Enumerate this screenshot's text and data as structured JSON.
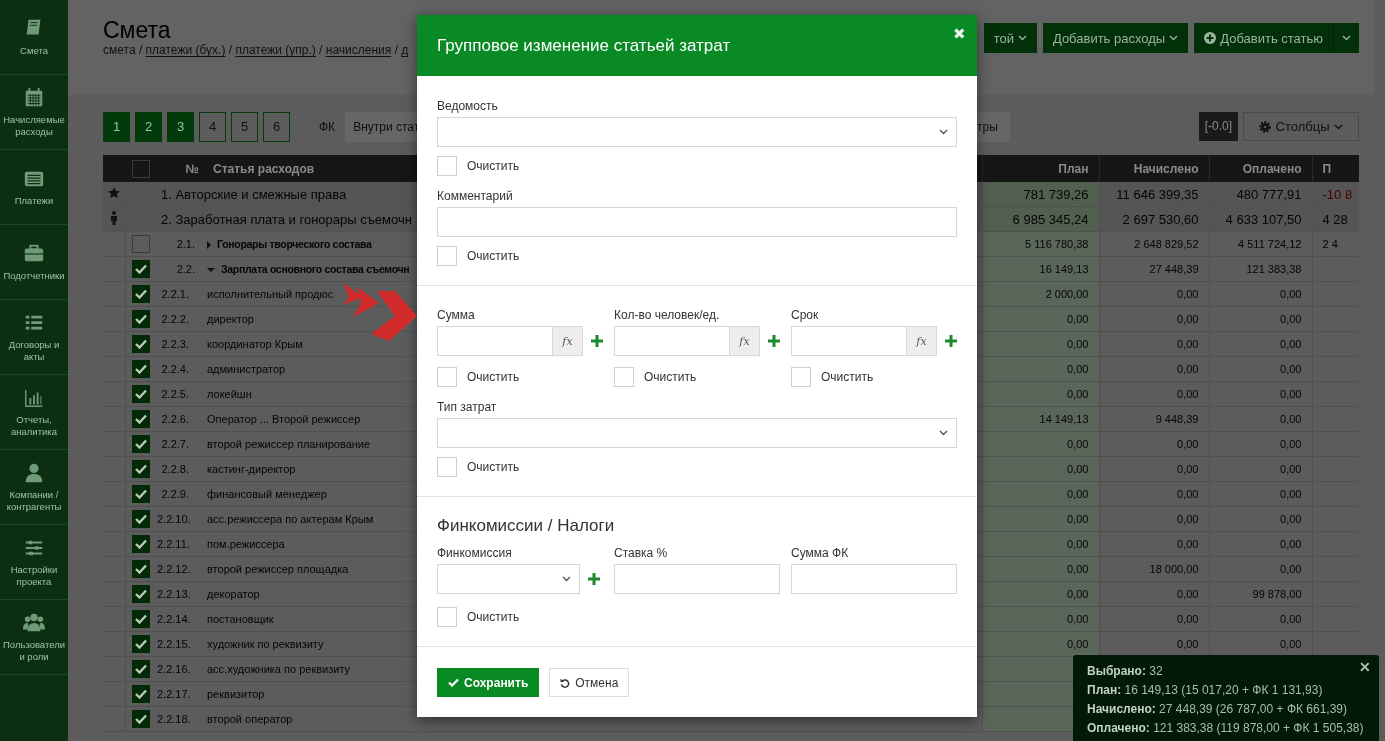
{
  "sidebar": {
    "items": [
      {
        "label": "Смета"
      },
      {
        "label": "Начисляемые расходы"
      },
      {
        "label": "Платежи"
      },
      {
        "label": "Подотчетники"
      },
      {
        "label": "Договоры и акты"
      },
      {
        "label": "Отчеты, аналитика"
      },
      {
        "label": "Компании / контрагенты"
      },
      {
        "label": "Настройки проекта"
      },
      {
        "label": "Пользователи и роли"
      }
    ]
  },
  "header": {
    "title": "Смета",
    "breadcrumbs": [
      {
        "label": "смета",
        "link": false
      },
      {
        "separator": "/",
        "label": "платежи (бух.)",
        "link": true
      },
      {
        "separator": "/",
        "label": "платежи (упр.)",
        "link": true
      },
      {
        "separator": "/",
        "label": "начисления",
        "link": true
      },
      {
        "separator": "/",
        "label": "д",
        "link": true
      }
    ],
    "actions": [
      {
        "label": "той",
        "kind": "dropdown"
      },
      {
        "label": "Добавить расходы",
        "kind": "dropdown"
      },
      {
        "label": "Добавить статью",
        "kind": "split"
      }
    ]
  },
  "toolbar": {
    "pages": [
      {
        "label": "1",
        "active": true
      },
      {
        "label": "2",
        "active": true
      },
      {
        "label": "3",
        "active": true
      },
      {
        "label": "4",
        "active": false
      },
      {
        "label": "5",
        "active": false
      },
      {
        "label": "6",
        "active": false
      }
    ],
    "fk_label": "ФК",
    "fk_select": "Внутри стат",
    "filters_button": "тры",
    "zoom_badge": "[-0.0]",
    "columns_button": "Столбцы"
  },
  "table": {
    "columns": [
      "№",
      "Статья расходов",
      "План",
      "Начислено",
      "Оплачено",
      "П"
    ],
    "header_checked": false,
    "rows": [
      {
        "kind": "group",
        "name": "1. Авторские и смежные права",
        "overdrawn": true,
        "values": [
          "781 739,26",
          "11 646 399,35",
          "480 777,91",
          "-10 8"
        ]
      },
      {
        "kind": "group",
        "name": "2. Заработная плата и гонорары съемочн",
        "overdrawn": false,
        "values": [
          "6 985 345,24",
          "2 697 530,60",
          "4 633 107,50",
          "4 28"
        ]
      },
      {
        "kind": "subgroup",
        "number": "2.1.",
        "name": "Гонорары творческого состава",
        "checked": false,
        "expanded": false,
        "values": [
          "5 116 780,38",
          "2 648 829,52",
          "4 511 724,12",
          "2 4"
        ]
      },
      {
        "kind": "subgroup",
        "number": "2.2.",
        "name": "Зарплата основного состава съемочн",
        "checked": true,
        "expanded": true,
        "values": [
          "16 149,13",
          "27 448,39",
          "121 383,38"
        ]
      },
      {
        "kind": "item",
        "number": "2.2.1.",
        "name": "исполнительный продюс",
        "checked": true,
        "values": [
          "2 000,00",
          "0,00",
          "0,00"
        ]
      },
      {
        "kind": "item",
        "number": "2.2.2.",
        "name": "директор",
        "checked": true,
        "values": [
          "0,00",
          "0,00",
          "0,00"
        ]
      },
      {
        "kind": "item",
        "number": "2.2.3.",
        "name": "координатор Крым",
        "checked": true,
        "values": [
          "0,00",
          "0,00",
          "0,00"
        ]
      },
      {
        "kind": "item",
        "number": "2.2.4.",
        "name": "администратор",
        "checked": true,
        "values": [
          "0,00",
          "0,00",
          "0,00"
        ]
      },
      {
        "kind": "item",
        "number": "2.2.5.",
        "name": "локейшн",
        "checked": true,
        "values": [
          "0,00",
          "0,00",
          "0,00"
        ]
      },
      {
        "kind": "item",
        "number": "2.2.6.",
        "name": "Оператор ... Второй режиссер",
        "checked": true,
        "values": [
          "14 149,13",
          "9 448,39",
          "0,00"
        ]
      },
      {
        "kind": "item",
        "number": "2.2.7.",
        "name": "второй режиссер планирование",
        "checked": true,
        "values": [
          "0,00",
          "0,00",
          "0,00"
        ]
      },
      {
        "kind": "item",
        "number": "2.2.8.",
        "name": "кастинг-директор",
        "checked": true,
        "values": [
          "0,00",
          "0,00",
          "0,00"
        ]
      },
      {
        "kind": "item",
        "number": "2.2.9.",
        "name": "финансовый менеджер",
        "checked": true,
        "values": [
          "0,00",
          "0,00",
          "0,00"
        ]
      },
      {
        "kind": "item",
        "number": "2.2.10.",
        "name": "асс.режиссера по актерам Крым",
        "checked": true,
        "values": [
          "0,00",
          "0,00",
          "0,00"
        ]
      },
      {
        "kind": "item",
        "number": "2.2.11.",
        "name": "пом.режиссера",
        "checked": true,
        "values": [
          "0,00",
          "0,00",
          "0,00"
        ]
      },
      {
        "kind": "item",
        "number": "2.2.12.",
        "name": "второй режиссер площадка",
        "checked": true,
        "values": [
          "0,00",
          "18 000,00",
          "0,00"
        ]
      },
      {
        "kind": "item",
        "number": "2.2.13.",
        "name": "декоратор",
        "checked": true,
        "values": [
          "0,00",
          "0,00",
          "99 878,00"
        ]
      },
      {
        "kind": "item",
        "number": "2.2.14.",
        "name": "постановщик",
        "checked": true,
        "values": [
          "0,00",
          "0,00",
          "0,00"
        ]
      },
      {
        "kind": "item",
        "number": "2.2.15.",
        "name": "художник по реквизиту",
        "checked": true,
        "values": [
          "0,00",
          "0,00",
          "0,00"
        ]
      },
      {
        "kind": "item",
        "number": "2.2.16.",
        "name": "асс.художника по реквизиту",
        "checked": true
      },
      {
        "kind": "item",
        "number": "2.2.17.",
        "name": "реквизитор",
        "checked": true
      },
      {
        "kind": "item",
        "number": "2.2.18.",
        "name": "второй оператор",
        "checked": true
      }
    ]
  },
  "modal": {
    "title": "Групповое изменение статьей затрат",
    "close": "✖",
    "groups": [
      {
        "fields": [
          {
            "kind": "select",
            "label": "Ведомость",
            "clear": "Очистить",
            "clear_checked": false
          },
          {
            "kind": "text",
            "label": "Комментарий",
            "clear": "Очистить",
            "clear_checked": false
          }
        ]
      },
      {
        "fields": [
          {
            "kind": "row",
            "cells": [
              {
                "label": "Сумма",
                "kind": "formula",
                "fx": "fx",
                "add": true,
                "clear": "Очистить",
                "clear_checked": false
              },
              {
                "label": "Кол-во человек/ед.",
                "kind": "formula",
                "fx": "fx",
                "add": true,
                "clear": "Очистить",
                "clear_checked": false
              },
              {
                "label": "Срок",
                "kind": "formula",
                "fx": "fx",
                "add": true,
                "clear": "Очистить",
                "clear_checked": false
              }
            ]
          },
          {
            "kind": "select",
            "label": "Тип затрат",
            "clear": "Очистить",
            "clear_checked": false
          }
        ]
      },
      {
        "heading": "Финкомиссии / Налоги",
        "fields": [
          {
            "kind": "row",
            "cells": [
              {
                "label": "Финкомиссия",
                "kind": "select",
                "add": true
              },
              {
                "label": "Ставка %",
                "kind": "text",
                "add": false
              },
              {
                "label": "Сумма ФК",
                "kind": "text",
                "add": false
              }
            ]
          },
          {
            "kind": "clear",
            "clear": "Очистить",
            "clear_checked": false
          }
        ]
      }
    ],
    "buttons": [
      {
        "label": "Сохранить",
        "kind": "primary"
      },
      {
        "label": "Отмена",
        "kind": "default"
      }
    ]
  },
  "summary": {
    "lines": [
      {
        "label": "Выбрано:",
        "value": "32"
      },
      {
        "label": "План:",
        "value": "16 149,13 (15 017,20 + ФК 1 131,93)"
      },
      {
        "label": "Начислено:",
        "value": "27 448,39 (26 787,00 + ФК 661,39)"
      },
      {
        "label": "Оплачено:",
        "value": "121 383,38 (119 878,00 + ФК 1 505,38)"
      }
    ],
    "close": "✕"
  }
}
